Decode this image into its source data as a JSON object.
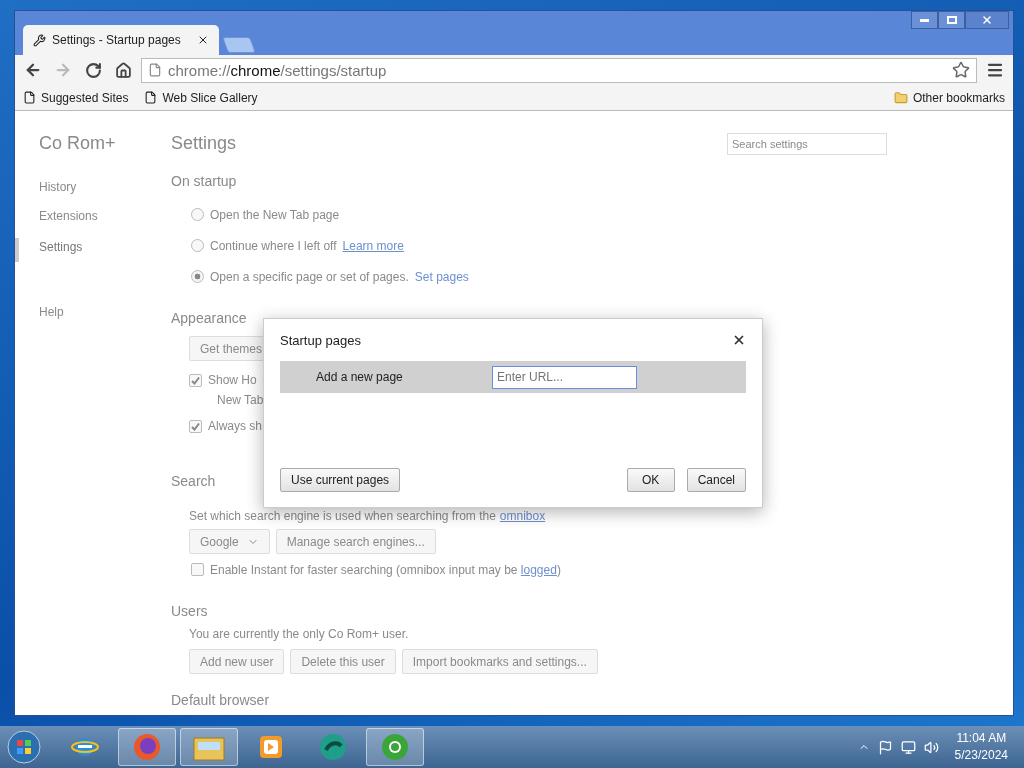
{
  "browser": {
    "tabs": [
      {
        "label": "Settings - Startup pages",
        "selected": true
      }
    ],
    "address": {
      "scheme": "chrome://",
      "host": "chrome",
      "path": "/settings/startup"
    },
    "bookmarks": [
      {
        "label": "Suggested Sites"
      },
      {
        "label": "Web Slice Gallery"
      }
    ],
    "other_bookmarks": "Other bookmarks"
  },
  "settings": {
    "brand": "Co Rom+",
    "nav": [
      {
        "label": "History",
        "selected": false
      },
      {
        "label": "Extensions",
        "selected": false
      },
      {
        "label": "Settings",
        "selected": true
      },
      {
        "label": "Help",
        "selected": false
      }
    ],
    "title": "Settings",
    "search": {
      "placeholder": "Search settings"
    },
    "startup": {
      "heading": "On startup",
      "options": [
        {
          "label": "Open the New Tab page",
          "selected": false
        },
        {
          "label": "Continue where I left off",
          "link": "Learn more",
          "selected": false
        },
        {
          "label": "Open a specific page or set of pages.",
          "link": "Set pages",
          "selected": true
        }
      ]
    },
    "appearance": {
      "heading": "Appearance",
      "button": "Get themes",
      "checks": [
        {
          "label": "Show Ho",
          "checked": true,
          "note": "New Tab"
        },
        {
          "label": "Always sh",
          "checked": true
        }
      ]
    },
    "search_section": {
      "heading": "Search",
      "text": "Set which search engine is used when searching from the",
      "link": "omnibox",
      "engine": "Google",
      "manage": "Manage search engines...",
      "instant": {
        "label": "Enable Instant for faster searching (omnibox input may be",
        "link": "logged",
        "tail": ")",
        "checked": false
      }
    },
    "users": {
      "heading": "Users",
      "text": "You are currently the only Co Rom+ user.",
      "buttons": [
        "Add new user",
        "Delete this user",
        "Import bookmarks and settings..."
      ]
    },
    "default_browser": {
      "heading": "Default browser"
    }
  },
  "dialog": {
    "title": "Startup pages",
    "row_label": "Add a new page",
    "url": {
      "placeholder": "Enter URL..."
    },
    "left_button": "Use current pages",
    "buttons": [
      "OK",
      "Cancel"
    ]
  },
  "taskbar": {
    "apps": [
      {
        "kind": "ie",
        "running": false
      },
      {
        "kind": "firefox",
        "running": true
      },
      {
        "kind": "explorer",
        "running": true
      },
      {
        "kind": "media",
        "running": false
      },
      {
        "kind": "teal",
        "running": false
      },
      {
        "kind": "chrome",
        "running": true
      }
    ],
    "time": "11:04 AM",
    "date": "5/23/2024"
  }
}
